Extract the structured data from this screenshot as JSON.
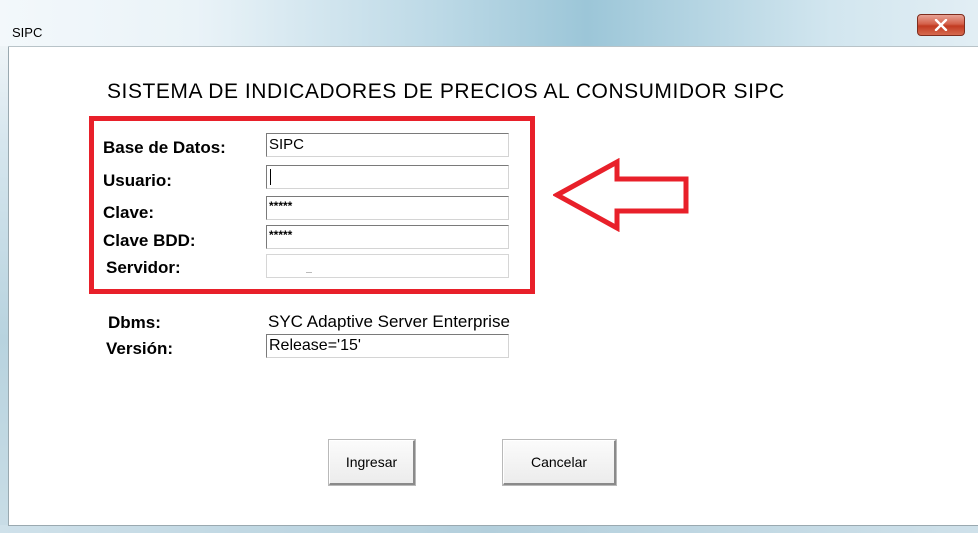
{
  "window": {
    "title": "SIPC"
  },
  "form": {
    "heading": "SISTEMA DE INDICADORES DE PRECIOS AL CONSUMIDOR SIPC",
    "fields": [
      {
        "label": "Base de Datos:",
        "value": "SIPC"
      },
      {
        "label": "Usuario:",
        "value": ""
      },
      {
        "label": "Clave:",
        "value": "*****"
      },
      {
        "label": "Clave BDD:",
        "value": "*****"
      },
      {
        "label": "Servidor:",
        "value": ""
      }
    ],
    "dbms_label": "Dbms:",
    "dbms_value": "SYC Adaptive Server Enterprise",
    "version_label": "Versión:",
    "version_value": "Release='15'"
  },
  "buttons": {
    "ingresar": "Ingresar",
    "cancelar": "Cancelar"
  },
  "icons": {
    "close": "close-icon",
    "annotation": "left-arrow-icon"
  },
  "colors": {
    "highlight": "#e8202a"
  }
}
